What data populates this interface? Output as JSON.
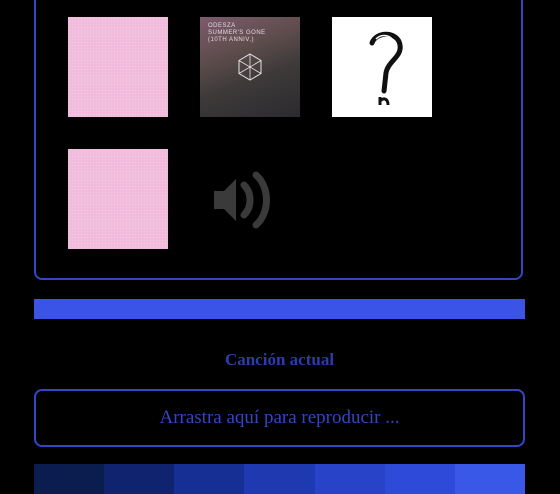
{
  "gallery": {
    "items": [
      {
        "name": "pink-album-cover-1",
        "style": "pink"
      },
      {
        "name": "odesza-album-cover",
        "style": "odesza",
        "cover_text": [
          "ODESZA",
          "SUMMER'S GONE",
          "(10TH ANNIV.)"
        ]
      },
      {
        "name": "xxxtentacion-question-mark-cover",
        "style": "white"
      },
      {
        "name": "pink-album-cover-2",
        "style": "pink"
      },
      {
        "name": "speaker-volume-icon",
        "style": "speaker"
      }
    ]
  },
  "player": {
    "progress": 1.0,
    "now_playing_label": "Canción actual",
    "drop_hint": "Arrastra aquí para reproducir ..."
  },
  "swatches": [
    "#0b1d4f",
    "#10236f",
    "#162f95",
    "#1f3ab0",
    "#2843c8",
    "#2e4ad8",
    "#3a58e8"
  ],
  "colors": {
    "accent": "#3346c4",
    "progress": "#3954e6",
    "pink": "#f1b9dc"
  }
}
